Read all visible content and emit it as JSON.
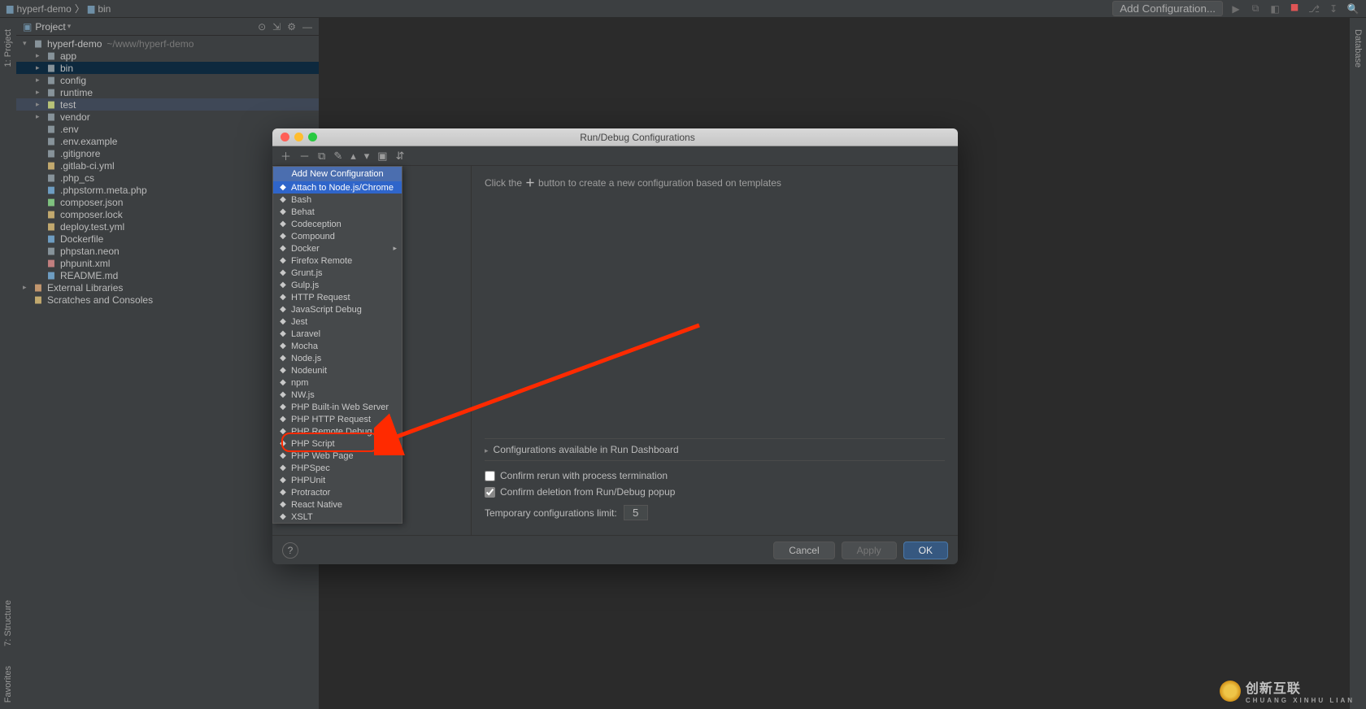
{
  "breadcrumb": {
    "root": "hyperf-demo",
    "child": "bin"
  },
  "topbar": {
    "add_config": "Add Configuration..."
  },
  "panel": {
    "title": "Project"
  },
  "side_tabs": {
    "project": "1: Project",
    "structure": "7: Structure",
    "favorites": "Favorites",
    "database": "Database"
  },
  "tree": {
    "root": {
      "name": "hyperf-demo",
      "path": "~/www/hyperf-demo"
    },
    "items": [
      {
        "type": "folder",
        "label": "app",
        "indent": 1,
        "arrow": "closed"
      },
      {
        "type": "folder",
        "label": "bin",
        "indent": 1,
        "arrow": "closed",
        "selected": true
      },
      {
        "type": "folder",
        "label": "config",
        "indent": 1,
        "arrow": "closed"
      },
      {
        "type": "folder",
        "label": "runtime",
        "indent": 1,
        "arrow": "closed"
      },
      {
        "type": "folder-open",
        "label": "test",
        "indent": 1,
        "arrow": "closed",
        "sel2": true
      },
      {
        "type": "folder",
        "label": "vendor",
        "indent": 1,
        "arrow": "closed"
      },
      {
        "type": "file",
        "label": ".env",
        "indent": 1,
        "arrow": "none"
      },
      {
        "type": "file",
        "label": ".env.example",
        "indent": 1,
        "arrow": "none"
      },
      {
        "type": "file",
        "label": ".gitignore",
        "indent": 1,
        "arrow": "none"
      },
      {
        "type": "file-y",
        "label": ".gitlab-ci.yml",
        "indent": 1,
        "arrow": "none"
      },
      {
        "type": "file",
        "label": ".php_cs",
        "indent": 1,
        "arrow": "none"
      },
      {
        "type": "file-b",
        "label": ".phpstorm.meta.php",
        "indent": 1,
        "arrow": "none"
      },
      {
        "type": "file-g",
        "label": "composer.json",
        "indent": 1,
        "arrow": "none"
      },
      {
        "type": "file-y",
        "label": "composer.lock",
        "indent": 1,
        "arrow": "none"
      },
      {
        "type": "file-y",
        "label": "deploy.test.yml",
        "indent": 1,
        "arrow": "none"
      },
      {
        "type": "file-b",
        "label": "Dockerfile",
        "indent": 1,
        "arrow": "none"
      },
      {
        "type": "file",
        "label": "phpstan.neon",
        "indent": 1,
        "arrow": "none"
      },
      {
        "type": "file-r",
        "label": "phpunit.xml",
        "indent": 1,
        "arrow": "none"
      },
      {
        "type": "file-b",
        "label": "README.md",
        "indent": 1,
        "arrow": "none"
      }
    ],
    "extlib": "External Libraries",
    "scratches": "Scratches and Consoles"
  },
  "modal": {
    "title": "Run/Debug Configurations",
    "hint_pre": "Click the",
    "hint_post": "button to create a new configuration based on templates",
    "dd_header": "Add New Configuration",
    "items": [
      {
        "label": "Attach to Node.js/Chrome",
        "selected": true
      },
      {
        "label": "Bash"
      },
      {
        "label": "Behat"
      },
      {
        "label": "Codeception"
      },
      {
        "label": "Compound"
      },
      {
        "label": "Docker",
        "sub": true
      },
      {
        "label": "Firefox Remote"
      },
      {
        "label": "Grunt.js"
      },
      {
        "label": "Gulp.js"
      },
      {
        "label": "HTTP Request"
      },
      {
        "label": "JavaScript Debug"
      },
      {
        "label": "Jest"
      },
      {
        "label": "Laravel"
      },
      {
        "label": "Mocha"
      },
      {
        "label": "Node.js"
      },
      {
        "label": "Nodeunit"
      },
      {
        "label": "npm"
      },
      {
        "label": "NW.js"
      },
      {
        "label": "PHP Built-in Web Server"
      },
      {
        "label": "PHP HTTP Request"
      },
      {
        "label": "PHP Remote Debug"
      },
      {
        "label": "PHP Script"
      },
      {
        "label": "PHP Web Page"
      },
      {
        "label": "PHPSpec"
      },
      {
        "label": "PHPUnit"
      },
      {
        "label": "Protractor"
      },
      {
        "label": "React Native"
      },
      {
        "label": "XSLT"
      }
    ],
    "collapsible": "Configurations available in Run Dashboard",
    "check1": "Confirm rerun with process termination",
    "check2": "Confirm deletion from Run/Debug popup",
    "limit_label": "Temporary configurations limit:",
    "limit_value": "5",
    "cancel": "Cancel",
    "apply": "Apply",
    "ok": "OK"
  },
  "watermark": {
    "main": "创新互联",
    "sub": "CHUANG XINHU LIAN"
  }
}
